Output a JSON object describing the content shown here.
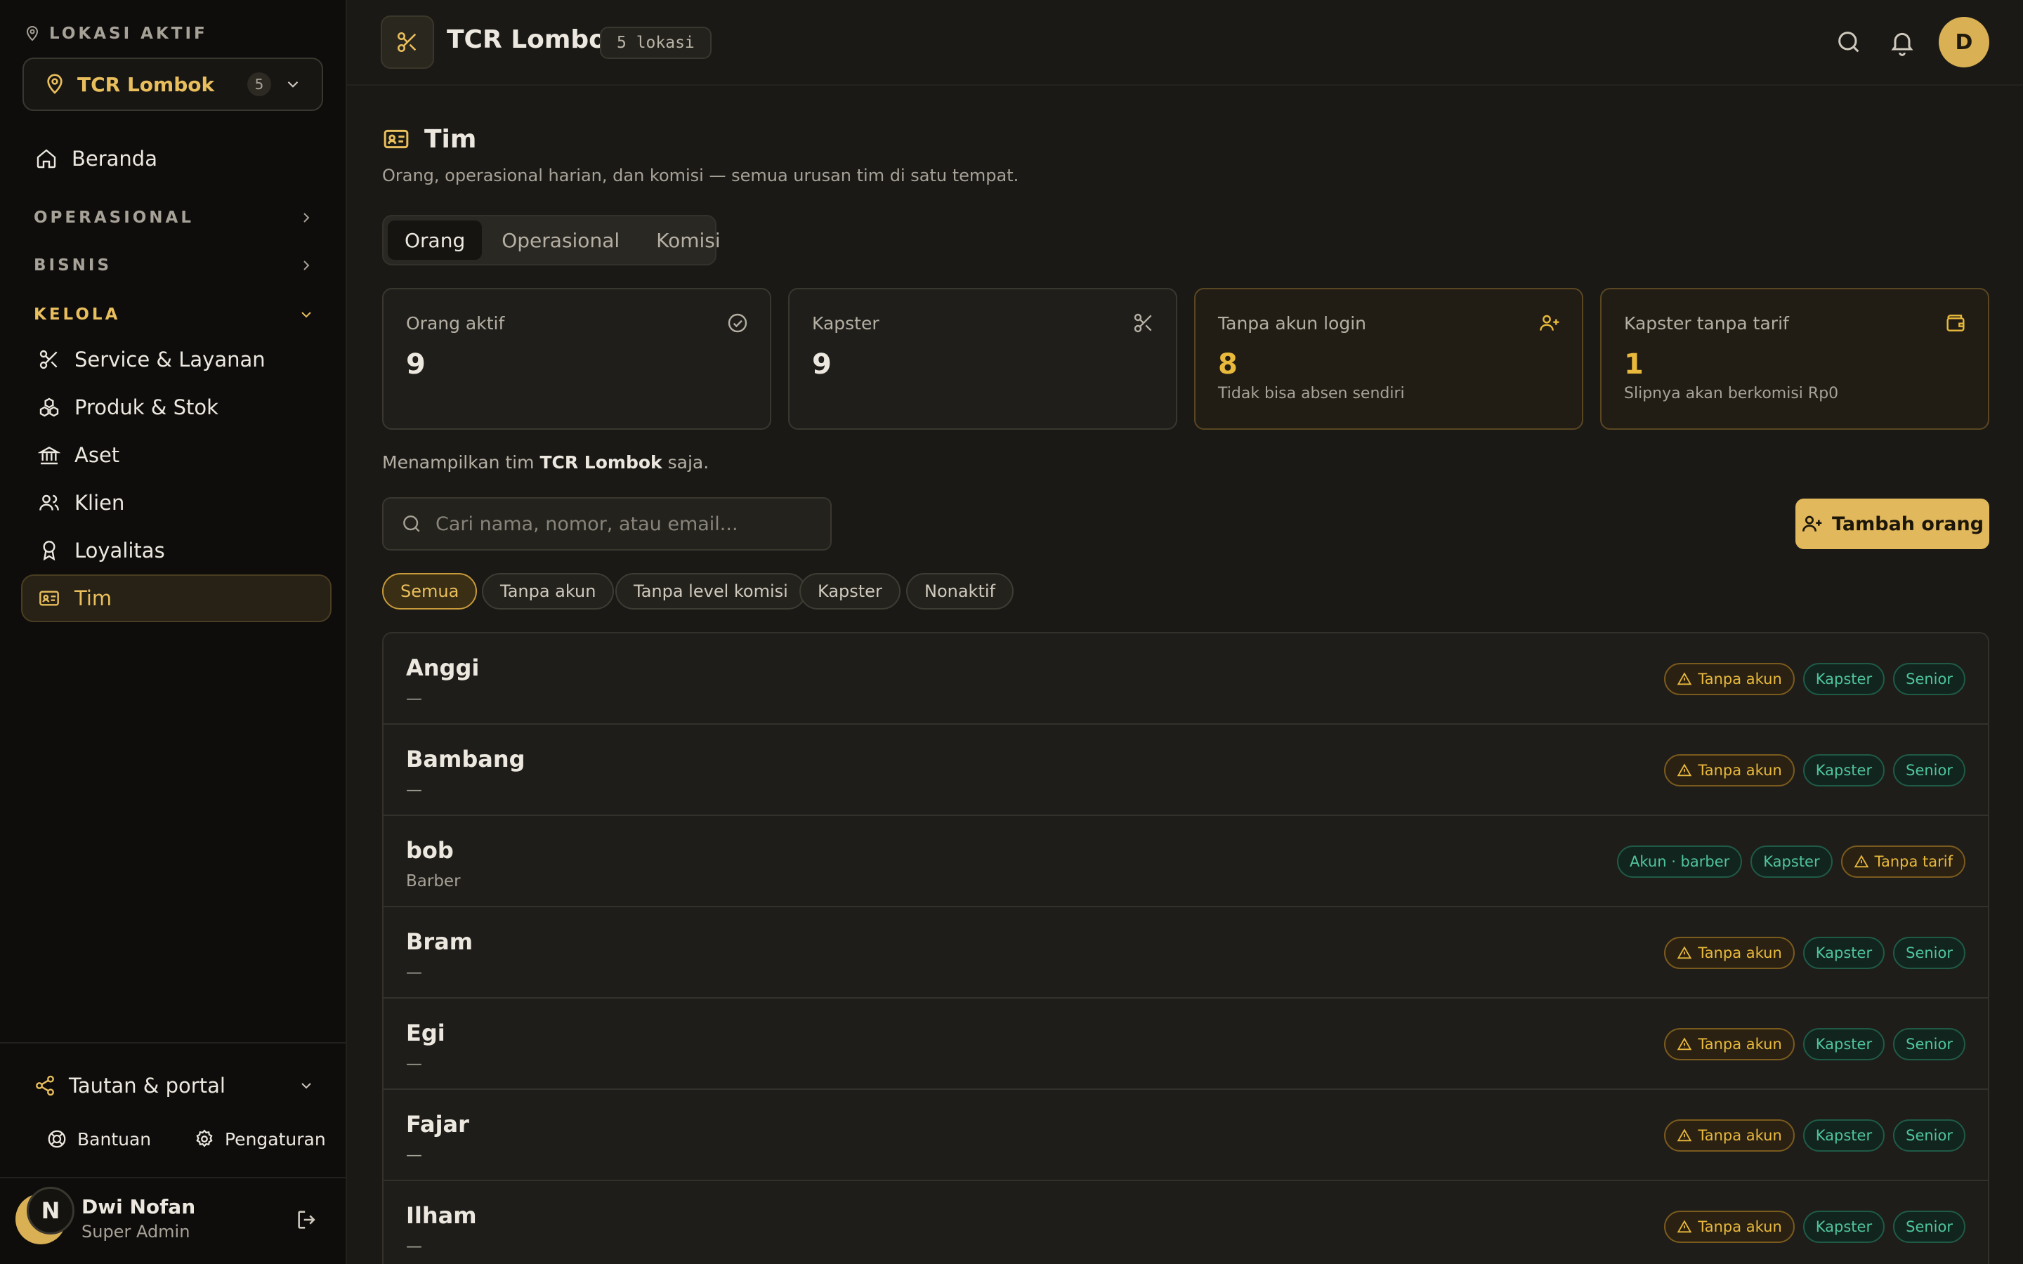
{
  "sidebar": {
    "location_label": "LOKASI AKTIF",
    "location_name": "TCR Lombok",
    "location_count": "5",
    "home": "Beranda",
    "sections": {
      "operasional": "OPERASIONAL",
      "bisnis": "BISNIS",
      "kelola": "KELOLA"
    },
    "items": [
      {
        "label": "Service & Layanan",
        "icon": "scissors-icon"
      },
      {
        "label": "Produk & Stok",
        "icon": "boxes-icon"
      },
      {
        "label": "Aset",
        "icon": "bank-icon"
      },
      {
        "label": "Klien",
        "icon": "users-icon"
      },
      {
        "label": "Loyalitas",
        "icon": "award-icon"
      },
      {
        "label": "Tim",
        "icon": "id-card-icon"
      }
    ],
    "portal": "Tautan & portal",
    "help": "Bantuan",
    "settings": "Pengaturan",
    "user": {
      "initial": "N",
      "name": "Dwi Nofan",
      "role": "Super Admin"
    }
  },
  "topbar": {
    "title": "TCR Lombok",
    "location_pill": "5 lokasi",
    "avatar_initial": "D"
  },
  "page": {
    "title": "Tim",
    "subtitle": "Orang, operasional harian, dan komisi — semua urusan tim di satu tempat.",
    "tabs": [
      "Orang",
      "Operasional",
      "Komisi"
    ],
    "active_tab": "Orang"
  },
  "stats": [
    {
      "label": "Orang aktif",
      "value": "9",
      "hint": "",
      "icon": "check-circle-icon"
    },
    {
      "label": "Kapster",
      "value": "9",
      "hint": "",
      "icon": "scissors-icon"
    },
    {
      "label": "Tanpa akun login",
      "value": "8",
      "hint": "Tidak bisa absen sendiri",
      "icon": "user-plus-icon"
    },
    {
      "label": "Kapster tanpa tarif",
      "value": "1",
      "hint": "Slipnya akan berkomisi Rp0",
      "icon": "wallet-icon"
    }
  ],
  "scope": {
    "prefix": "Menampilkan tim ",
    "location": "TCR Lombok",
    "suffix": " saja."
  },
  "search": {
    "placeholder": "Cari nama, nomor, atau email...",
    "value": ""
  },
  "add_button": "Tambah orang",
  "filters": [
    "Semua",
    "Tanpa akun",
    "Tanpa level komisi",
    "Kapster",
    "Nonaktif"
  ],
  "active_filter": "Semua",
  "people": [
    {
      "name": "Anggi",
      "sub": "—",
      "badges": [
        {
          "t": "Tanpa akun",
          "k": "warn"
        },
        {
          "t": "Kapster",
          "k": "ok"
        },
        {
          "t": "Senior",
          "k": "ok"
        }
      ]
    },
    {
      "name": "Bambang",
      "sub": "—",
      "badges": [
        {
          "t": "Tanpa akun",
          "k": "warn"
        },
        {
          "t": "Kapster",
          "k": "ok"
        },
        {
          "t": "Senior",
          "k": "ok"
        }
      ]
    },
    {
      "name": "bob",
      "sub": "Barber",
      "badges": [
        {
          "t": "Akun · barber",
          "k": "ok"
        },
        {
          "t": "Kapster",
          "k": "ok"
        },
        {
          "t": "Tanpa tarif",
          "k": "warn"
        }
      ]
    },
    {
      "name": "Bram",
      "sub": "—",
      "badges": [
        {
          "t": "Tanpa akun",
          "k": "warn"
        },
        {
          "t": "Kapster",
          "k": "ok"
        },
        {
          "t": "Senior",
          "k": "ok"
        }
      ]
    },
    {
      "name": "Egi",
      "sub": "—",
      "badges": [
        {
          "t": "Tanpa akun",
          "k": "warn"
        },
        {
          "t": "Kapster",
          "k": "ok"
        },
        {
          "t": "Senior",
          "k": "ok"
        }
      ]
    },
    {
      "name": "Fajar",
      "sub": "—",
      "badges": [
        {
          "t": "Tanpa akun",
          "k": "warn"
        },
        {
          "t": "Kapster",
          "k": "ok"
        },
        {
          "t": "Senior",
          "k": "ok"
        }
      ]
    },
    {
      "name": "Ilham",
      "sub": "—",
      "badges": [
        {
          "t": "Tanpa akun",
          "k": "warn"
        },
        {
          "t": "Kapster",
          "k": "ok"
        },
        {
          "t": "Senior",
          "k": "ok"
        }
      ]
    }
  ],
  "colors": {
    "accent": "#e9be5c",
    "warn": "#e9b93c",
    "ok": "#4fc59d",
    "background": "#1a1916",
    "sidebar": "#0e0d0c"
  }
}
